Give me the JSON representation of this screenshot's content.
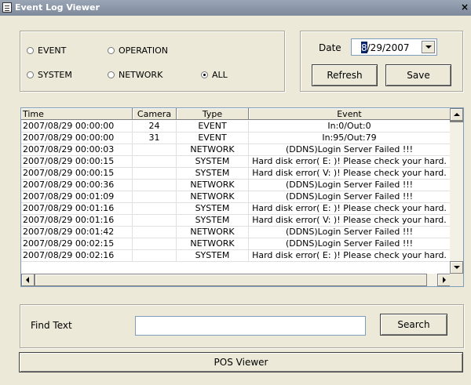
{
  "window": {
    "title": "Event Log Viewer",
    "close_glyph": "×"
  },
  "filters": {
    "options": [
      {
        "label": "EVENT",
        "selected": false
      },
      {
        "label": "OPERATION",
        "selected": false
      },
      {
        "label": "SYSTEM",
        "selected": false
      },
      {
        "label": "NETWORK",
        "selected": false
      },
      {
        "label": "ALL",
        "selected": true
      }
    ]
  },
  "date": {
    "label": "Date",
    "value_first": "8",
    "value_rest": "/29/2007"
  },
  "buttons": {
    "refresh": "Refresh",
    "save": "Save",
    "search": "Search",
    "pos_viewer": "POS Viewer"
  },
  "find": {
    "label": "Find Text",
    "value": ""
  },
  "table": {
    "columns": [
      "Time",
      "Camera",
      "Type",
      "Event"
    ],
    "rows": [
      [
        "2007/08/29 00:00:00",
        "24",
        "EVENT",
        "In:0/Out:0"
      ],
      [
        "2007/08/29 00:00:00",
        "31",
        "EVENT",
        "In:95/Out:79"
      ],
      [
        "2007/08/29 00:00:03",
        "",
        "NETWORK",
        "(DDNS)Login Server Failed !!!"
      ],
      [
        "2007/08/29 00:00:15",
        "",
        "SYSTEM",
        "Hard disk error( E: )! Please check your hard."
      ],
      [
        "2007/08/29 00:00:15",
        "",
        "SYSTEM",
        "Hard disk error( V: )! Please check your hard."
      ],
      [
        "2007/08/29 00:00:36",
        "",
        "NETWORK",
        "(DDNS)Login Server Failed !!!"
      ],
      [
        "2007/08/29 00:01:09",
        "",
        "NETWORK",
        "(DDNS)Login Server Failed !!!"
      ],
      [
        "2007/08/29 00:01:16",
        "",
        "SYSTEM",
        "Hard disk error( E: )! Please check your hard."
      ],
      [
        "2007/08/29 00:01:16",
        "",
        "SYSTEM",
        "Hard disk error( V: )! Please check your hard."
      ],
      [
        "2007/08/29 00:01:42",
        "",
        "NETWORK",
        "(DDNS)Login Server Failed !!!"
      ],
      [
        "2007/08/29 00:02:15",
        "",
        "NETWORK",
        "(DDNS)Login Server Failed !!!"
      ],
      [
        "2007/08/29 00:02:16",
        "",
        "SYSTEM",
        "Hard disk error( E: )! Please check your hard."
      ]
    ]
  }
}
